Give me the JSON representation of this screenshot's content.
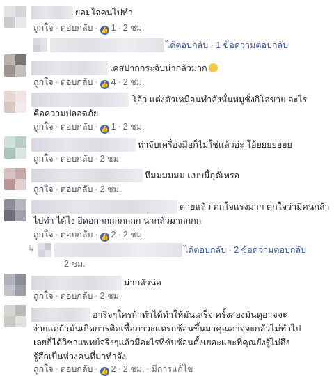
{
  "labels": {
    "like": "ถูกใจ",
    "reply": "ตอบกลับ",
    "dot": "·"
  },
  "comments": [
    {
      "text": "ยอมใจคนไปทำ",
      "likes": "1",
      "time": "2 ชม."
    },
    {
      "text": "เคสปากกระจับน่ากลัวมาก",
      "likes": "4",
      "time": "2 ชม."
    },
    {
      "text_line1": "โอ้ว แต่งตัวเหมือนทำลังหั่นหมูชั่งกิโลขาย อะไร",
      "text_line2": "คือความปลอดภัย",
      "likes": "1",
      "time": "2 ชม."
    },
    {
      "text": "ท่าจับเครื่องมือก็ไม่ใช่แล้วอ่ะ โอ้ยยยยยยย",
      "time": "2 ชม."
    },
    {
      "text": "หึมมมมมม แบบนี้กุดัเหรอ",
      "time": "2 ชม."
    },
    {
      "text_line1": "ตายแล้ว ตกใจแรงมาก ตกใจว่ามีคนกล้า",
      "text_line2": "ไปทำ ได้ไง อีดอกกกกกกกกก น่ากลัวมากกกก",
      "likes": "2",
      "time": "2 ชม."
    },
    {
      "text": "น่ากลัวน่อ",
      "time": "2 ชม."
    },
    {
      "text_line1": "อาริจๆใครถ้าทำได้ทำให้มันเสร็จ ครั้งสองมันดูอาจจะ",
      "text_line2": "ง่ายแต่ถ้ามันเกิดการติดเชื้อภาวะแทรกซ้อนขึ้นมาคุณอาจจะกลัวไม่ทำไป",
      "text_line3": "เลยก็ได้วิชาแพทย์จริงๆแล้วมีอะไรที่ซับซ้อนตั้งเยอะแยะที่คุณยังรู้ไม่ถึง",
      "text_line4": "รู้สึกเป็นห่วงคนที่มาทำจัง",
      "likes": "2",
      "time": "2 ชม.",
      "edited": "มีการแก้ไข"
    }
  ],
  "reply_summaries": [
    {
      "text": "ได้ตอบกลับ · 1 ข้อความตอบกลับ"
    },
    {
      "text": "ได้ตอบกลับ · 2 ข้อความตอบกลับ",
      "time": "2 ชม."
    }
  ],
  "colors": {
    "link": "#385898",
    "like_blue": "#4267b2",
    "muted": "#606770"
  }
}
